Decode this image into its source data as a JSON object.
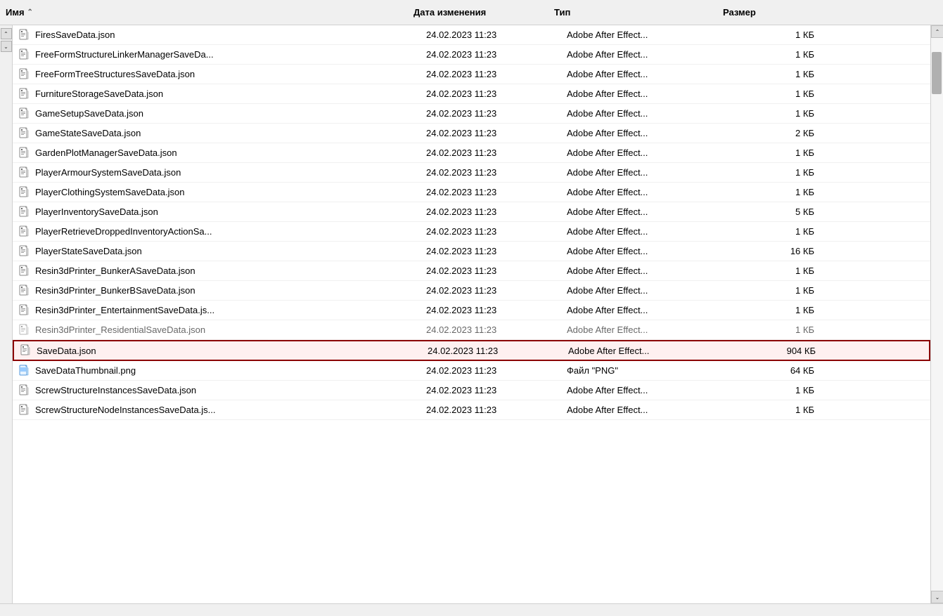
{
  "columns": {
    "name": "Имя",
    "date": "Дата изменения",
    "type": "Тип",
    "size": "Размер"
  },
  "files": [
    {
      "id": 1,
      "name": "FiresSaveData.json",
      "date": "24.02.2023 11:23",
      "type": "Adobe After Effect...",
      "size": "1 КБ",
      "icon": "json",
      "highlighted": false
    },
    {
      "id": 2,
      "name": "FreeFormStructureLinkerManagerSaveDa...",
      "date": "24.02.2023 11:23",
      "type": "Adobe After Effect...",
      "size": "1 КБ",
      "icon": "json",
      "highlighted": false
    },
    {
      "id": 3,
      "name": "FreeFormTreeStructuresSaveData.json",
      "date": "24.02.2023 11:23",
      "type": "Adobe After Effect...",
      "size": "1 КБ",
      "icon": "json",
      "highlighted": false
    },
    {
      "id": 4,
      "name": "FurnitureStorageSaveData.json",
      "date": "24.02.2023 11:23",
      "type": "Adobe After Effect...",
      "size": "1 КБ",
      "icon": "json",
      "highlighted": false
    },
    {
      "id": 5,
      "name": "GameSetupSaveData.json",
      "date": "24.02.2023 11:23",
      "type": "Adobe After Effect...",
      "size": "1 КБ",
      "icon": "json",
      "highlighted": false
    },
    {
      "id": 6,
      "name": "GameStateSaveData.json",
      "date": "24.02.2023 11:23",
      "type": "Adobe After Effect...",
      "size": "2 КБ",
      "icon": "json",
      "highlighted": false
    },
    {
      "id": 7,
      "name": "GardenPlotManagerSaveData.json",
      "date": "24.02.2023 11:23",
      "type": "Adobe After Effect...",
      "size": "1 КБ",
      "icon": "json",
      "highlighted": false
    },
    {
      "id": 8,
      "name": "PlayerArmourSystemSaveData.json",
      "date": "24.02.2023 11:23",
      "type": "Adobe After Effect...",
      "size": "1 КБ",
      "icon": "json",
      "highlighted": false
    },
    {
      "id": 9,
      "name": "PlayerClothingSystemSaveData.json",
      "date": "24.02.2023 11:23",
      "type": "Adobe After Effect...",
      "size": "1 КБ",
      "icon": "json",
      "highlighted": false
    },
    {
      "id": 10,
      "name": "PlayerInventorySaveData.json",
      "date": "24.02.2023 11:23",
      "type": "Adobe After Effect...",
      "size": "5 КБ",
      "icon": "json",
      "highlighted": false
    },
    {
      "id": 11,
      "name": "PlayerRetrieveDroppedInventoryActionSa...",
      "date": "24.02.2023 11:23",
      "type": "Adobe After Effect...",
      "size": "1 КБ",
      "icon": "json",
      "highlighted": false
    },
    {
      "id": 12,
      "name": "PlayerStateSaveData.json",
      "date": "24.02.2023 11:23",
      "type": "Adobe After Effect...",
      "size": "16 КБ",
      "icon": "json",
      "highlighted": false
    },
    {
      "id": 13,
      "name": "Resin3dPrinter_BunkerASaveData.json",
      "date": "24.02.2023 11:23",
      "type": "Adobe After Effect...",
      "size": "1 КБ",
      "icon": "json",
      "highlighted": false
    },
    {
      "id": 14,
      "name": "Resin3dPrinter_BunkerBSaveData.json",
      "date": "24.02.2023 11:23",
      "type": "Adobe After Effect...",
      "size": "1 КБ",
      "icon": "json",
      "highlighted": false
    },
    {
      "id": 15,
      "name": "Resin3dPrinter_EntertainmentSaveData.js...",
      "date": "24.02.2023 11:23",
      "type": "Adobe After Effect...",
      "size": "1 КБ",
      "icon": "json",
      "highlighted": false
    },
    {
      "id": 16,
      "name": "Resin3dPrinter_ResidentialSaveData.json",
      "date": "24.02.2023 11:23",
      "type": "Adobe After Effect...",
      "size": "1 КБ",
      "icon": "json",
      "highlighted": false,
      "faded": true
    },
    {
      "id": 17,
      "name": "SaveData.json",
      "date": "24.02.2023 11:23",
      "type": "Adobe After Effect...",
      "size": "904 КБ",
      "icon": "json",
      "highlighted": true
    },
    {
      "id": 18,
      "name": "SaveDataThumbnail.png",
      "date": "24.02.2023 11:23",
      "type": "Файл \"PNG\"",
      "size": "64 КБ",
      "icon": "png",
      "highlighted": false
    },
    {
      "id": 19,
      "name": "ScrewStructureInstancesSaveData.json",
      "date": "24.02.2023 11:23",
      "type": "Adobe After Effect...",
      "size": "1 КБ",
      "icon": "json",
      "highlighted": false
    },
    {
      "id": 20,
      "name": "ScrewStructureNodeInstancesSaveData.js...",
      "date": "24.02.2023 11:23",
      "type": "Adobe After Effect...",
      "size": "1 КБ",
      "icon": "json",
      "highlighted": false
    }
  ]
}
